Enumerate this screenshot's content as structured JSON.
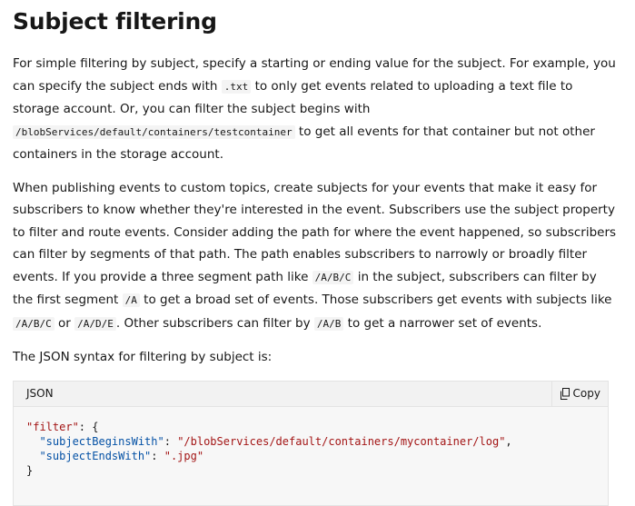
{
  "heading": "Subject filtering",
  "para1": {
    "t1": "For simple filtering by subject, specify a starting or ending value for the subject. For example, you can specify the subject ends with ",
    "c1": ".txt",
    "t2": " to only get events related to uploading a text file to storage account. Or, you can filter the subject begins with ",
    "c2": "/blobServices/default/containers/testcontainer",
    "t3": " to get all events for that container but not other containers in the storage account."
  },
  "para2": {
    "t1": "When publishing events to custom topics, create subjects for your events that make it easy for subscribers to know whether they're interested in the event. Subscribers use the subject property to filter and route events. Consider adding the path for where the event happened, so subscribers can filter by segments of that path. The path enables subscribers to narrowly or broadly filter events. If you provide a three segment path like ",
    "c1": "/A/B/C",
    "t2": " in the subject, subscribers can filter by the first segment ",
    "c2": "/A",
    "t3": " to get a broad set of events. Those subscribers get events with subjects like ",
    "c3": "/A/B/C",
    "t4": " or ",
    "c4": "/A/D/E",
    "t5": ". Other subscribers can filter by ",
    "c5": "/A/B",
    "t6": " to get a narrower set of events."
  },
  "para3": "The JSON syntax for filtering by subject is:",
  "code_block": {
    "language": "JSON",
    "copy_label": "Copy",
    "copy_icon": "copy-icon",
    "filter_key": "\"filter\"",
    "open": ": {",
    "begins_key": "\"subjectBeginsWith\"",
    "begins_val": "\"/blobServices/default/containers/mycontainer/log\"",
    "ends_key": "\"subjectEndsWith\"",
    "ends_val": "\".jpg\"",
    "close": "}"
  }
}
